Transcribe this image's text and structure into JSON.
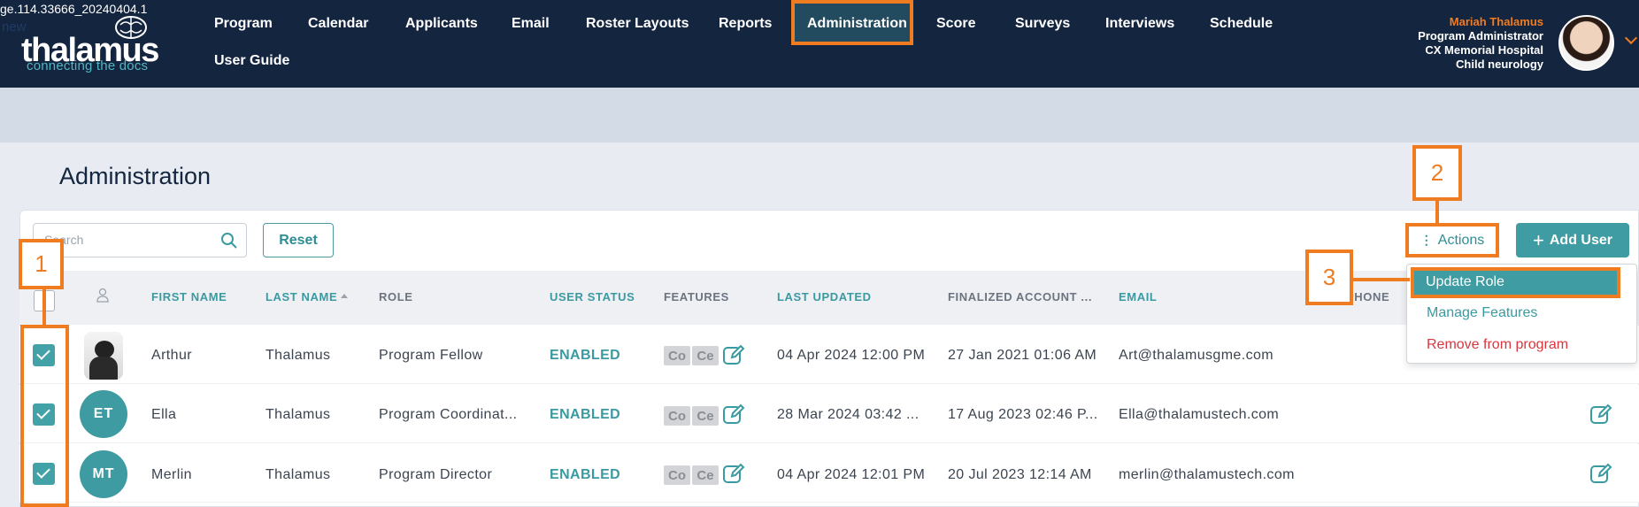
{
  "version": "ge.114.33666_20240404.1",
  "logo": {
    "word": "thalamus",
    "tagline": "connecting the docs"
  },
  "nav": {
    "items": [
      "Program",
      "Calendar",
      "Applicants",
      "Email",
      "Roster Layouts",
      "Reports",
      "Administration",
      "Score",
      "Surveys",
      "Interviews",
      "Schedule",
      "User Guide"
    ],
    "active": "Administration"
  },
  "user": {
    "name": "Mariah Thalamus",
    "role": "Program Administrator",
    "hospital": "CX Memorial Hospital",
    "department": "Child neurology"
  },
  "subbar": {
    "text": "new"
  },
  "page": {
    "title": "Administration"
  },
  "toolbar": {
    "search_placeholder": "Search",
    "reset_label": "Reset",
    "actions_label": "Actions",
    "add_user_label": "Add User"
  },
  "table": {
    "headers": {
      "first_name": "FIRST NAME",
      "last_name": "LAST NAME",
      "role": "ROLE",
      "user_status": "USER STATUS",
      "features": "FEATURES",
      "last_updated": "LAST UPDATED",
      "finalized": "FINALIZED ACCOUNT ...",
      "email": "EMAIL",
      "phone": "PHONE"
    },
    "rows": [
      {
        "avatar": "photo",
        "initials": "",
        "first_name": "Arthur",
        "last_name": "Thalamus",
        "role": "Program Fellow",
        "status": "ENABLED",
        "features": [
          "Co",
          "Ce"
        ],
        "last_updated": "04 Apr 2024 12:00 PM",
        "finalized": "27 Jan 2021 01:06 AM",
        "email": "Art@thalamusgme.com",
        "checked": true
      },
      {
        "avatar": "initials",
        "initials": "ET",
        "first_name": "Ella",
        "last_name": "Thalamus",
        "role": "Program Coordinat...",
        "status": "ENABLED",
        "features": [
          "Co",
          "Ce"
        ],
        "last_updated": "28 Mar 2024 03:42 ...",
        "finalized": "17 Aug 2023 02:46 P...",
        "email": "Ella@thalamustech.com",
        "checked": true
      },
      {
        "avatar": "initials",
        "initials": "MT",
        "first_name": "Merlin",
        "last_name": "Thalamus",
        "role": "Program Director",
        "status": "ENABLED",
        "features": [
          "Co",
          "Ce"
        ],
        "last_updated": "04 Apr 2024 12:01 PM",
        "finalized": "20 Jul 2023 12:14 AM",
        "email": "merlin@thalamustech.com",
        "checked": true
      }
    ]
  },
  "actions_menu": {
    "items": [
      {
        "label": "Update Role",
        "color": "#ffffff"
      },
      {
        "label": "Manage Features",
        "color": "#3a9aa1"
      },
      {
        "label": "Remove from program",
        "color": "#d9363e"
      }
    ]
  },
  "markers": [
    "1",
    "2",
    "3"
  ],
  "colors": {
    "navy": "#14253f",
    "teal": "#3e9ca2",
    "orange": "#f07c22",
    "red": "#d9363e"
  },
  "icons": [
    "search-icon",
    "person-icon",
    "edit-icon",
    "kebab-icon",
    "plus-icon",
    "sort-up-icon",
    "chevron-down-icon",
    "brain-icon"
  ]
}
